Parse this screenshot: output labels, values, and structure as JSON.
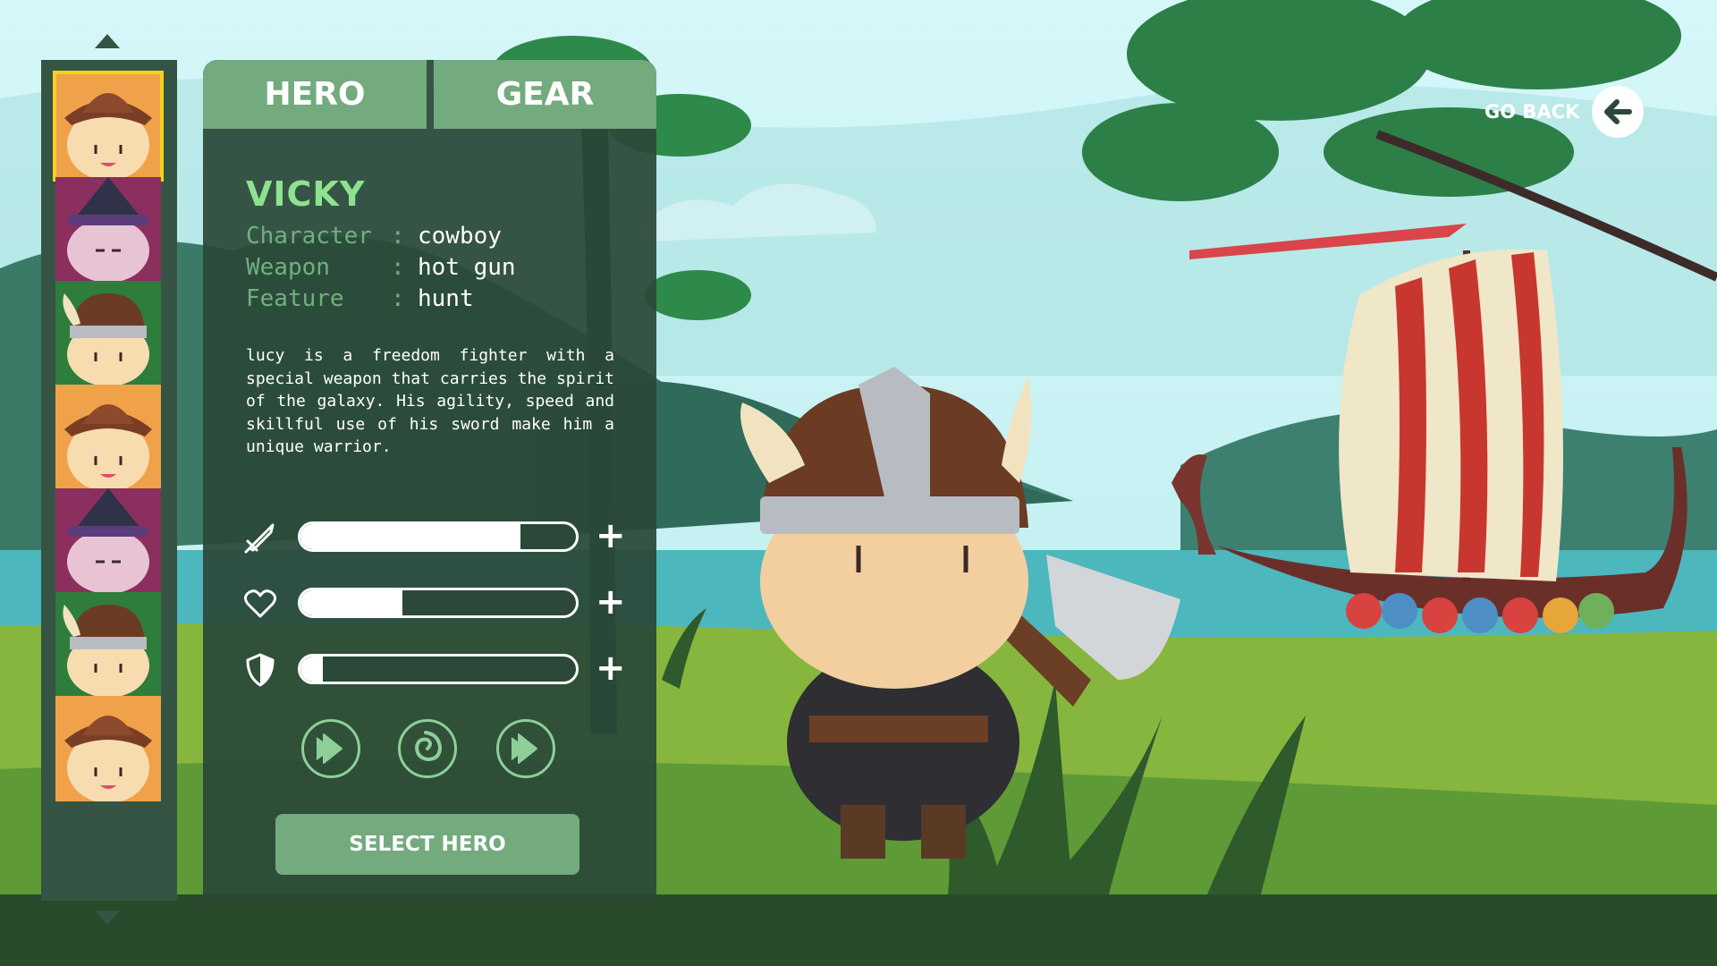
{
  "tabs": {
    "hero": "HERO",
    "gear": "GEAR"
  },
  "hero": {
    "name": "VICKY",
    "attributes": [
      {
        "label": "Character",
        "sep": ":",
        "value": "cowboy"
      },
      {
        "label": "Weapon",
        "sep": ":",
        "value": "hot gun"
      },
      {
        "label": "Feature",
        "sep": ":",
        "value": "hunt"
      }
    ],
    "description": "lucy is a freedom fighter with a special weapon that carries the spirit of the galaxy. His agility, speed and skillful use of his sword make him a unique warrior."
  },
  "stats": [
    {
      "icon": "sword-icon",
      "level": 0.8,
      "plus": "+"
    },
    {
      "icon": "heart-icon",
      "level": 0.37,
      "plus": "+"
    },
    {
      "icon": "shield-icon",
      "level": 0.08,
      "plus": "+"
    }
  ],
  "skills": [
    "dash-arrow-icon",
    "swirl-icon",
    "dash-arrow-icon"
  ],
  "hero_list": [
    {
      "type": "cowboy",
      "selected": true
    },
    {
      "type": "witch",
      "selected": false
    },
    {
      "type": "viking",
      "selected": false
    },
    {
      "type": "cowboy",
      "selected": false
    },
    {
      "type": "witch",
      "selected": false
    },
    {
      "type": "viking",
      "selected": false
    },
    {
      "type": "cowboy",
      "selected": false
    }
  ],
  "select_button": "SELECT HERO",
  "go_back": "GO BACK",
  "colors": {
    "panel": "#2b4838",
    "accent": "#73aa7e",
    "name": "#8ee28f",
    "selected_border": "#f7d11e"
  }
}
